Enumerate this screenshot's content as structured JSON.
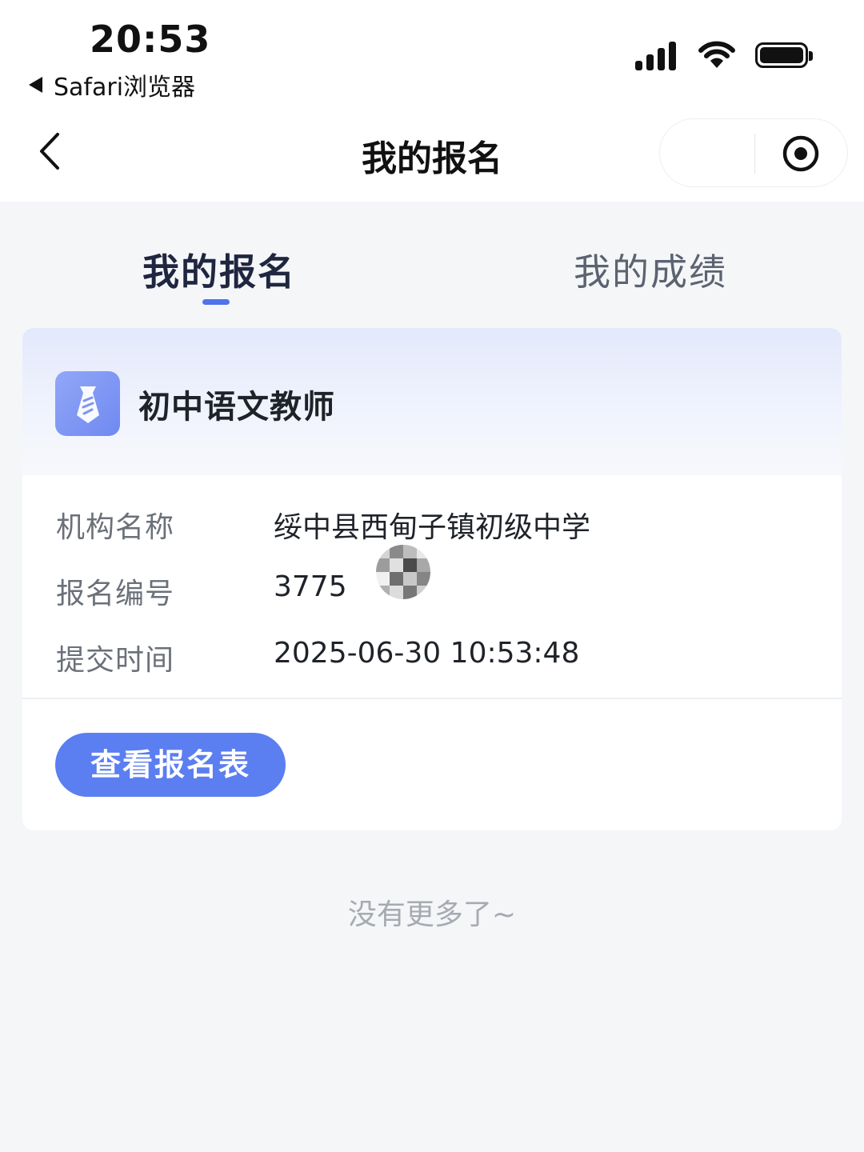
{
  "status_bar": {
    "time": "20:53",
    "back_app": "Safari浏览器",
    "icons": [
      "signal-icon",
      "wifi-icon",
      "battery-icon"
    ]
  },
  "nav": {
    "title": "我的报名",
    "icons": [
      "back-chevron-icon",
      "record-icon"
    ]
  },
  "tabs": [
    {
      "label": "我的报名",
      "active": true
    },
    {
      "label": "我的成绩",
      "active": false
    }
  ],
  "card": {
    "title": "初中语文教师",
    "icon": "tie-icon",
    "rows": [
      {
        "label": "机构名称",
        "value": "绥中县西甸子镇初级中学"
      },
      {
        "label": "报名编号",
        "value": "3775"
      },
      {
        "label": "提交时间",
        "value": "2025-06-30 10:53:48"
      }
    ],
    "button_label": "查看报名表"
  },
  "footer": {
    "no_more": "没有更多了~"
  },
  "colors": {
    "accent": "#5b7ef0",
    "tab_indicator": "#4f73ea",
    "background": "#f5f6f8"
  }
}
